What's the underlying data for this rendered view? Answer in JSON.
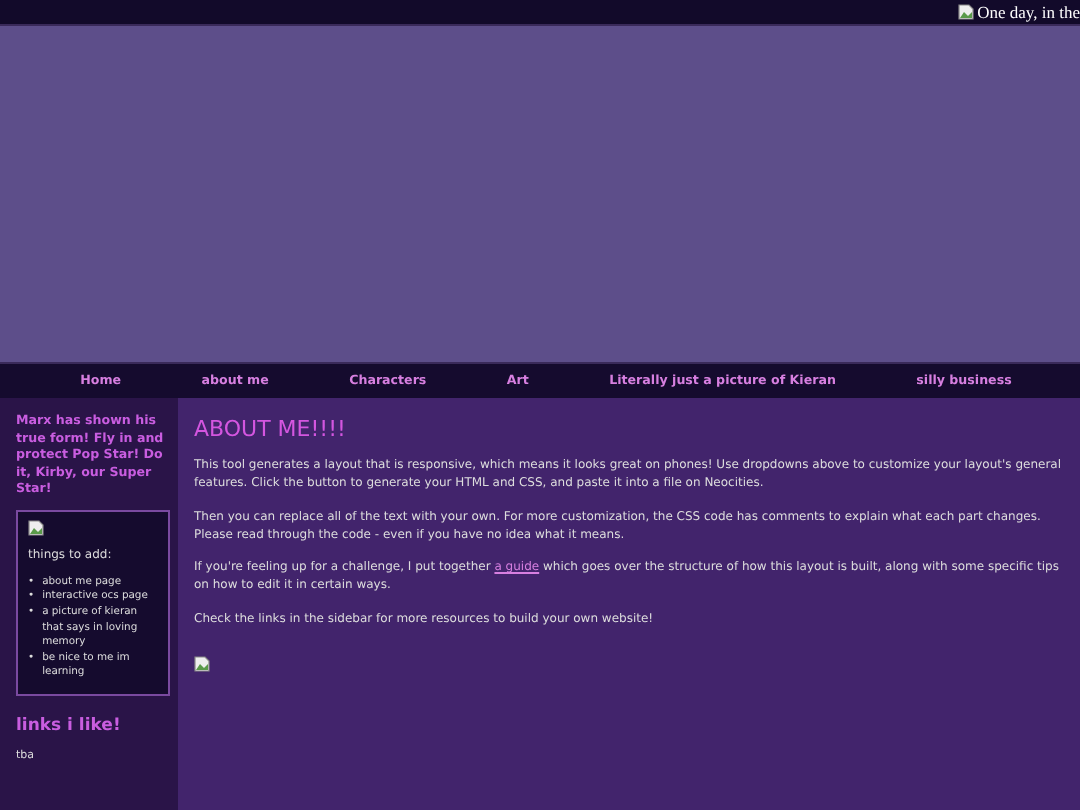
{
  "top_bar": {
    "marquee": "One day, in the"
  },
  "nav": [
    {
      "label": "Home"
    },
    {
      "label": "about me"
    },
    {
      "label": "Characters"
    },
    {
      "label": "Art"
    },
    {
      "label": "Literally just a picture of Kieran"
    },
    {
      "label": "silly business"
    }
  ],
  "sidebar": {
    "intro": "Marx has shown his true form! Fly in and protect Pop Star! Do it, Kirby, our Super Star!",
    "box": {
      "title": "things to add:",
      "items": [
        {
          "bullet": "•",
          "text": "about me page"
        },
        {
          "bullet": "•",
          "text": "interactive ocs page"
        },
        {
          "bullet": "•",
          "text": "a picture of kieran that says in loving memory"
        },
        {
          "bullet": "•",
          "text": "be nice to me im learning"
        }
      ]
    },
    "links_heading": "links i like!",
    "links_text": "tba"
  },
  "main": {
    "heading": "ABOUT ME!!!!",
    "paragraphs": [
      "This tool generates a layout that is responsive, which means it looks great on phones! Use dropdowns above to customize your layout's general features. Click the button to generate your HTML and CSS, and paste it into a file on Neocities.",
      "Then you can replace all of the text with your own. For more customization, the CSS code has comments to explain what each part changes. Please read through the code - even if you have no idea what it means.",
      {
        "before": "If you're feeling up for a challenge, I put together",
        "link": "a guide",
        "after": "which goes over the structure of how this layout is built, along with some specific tips on how to edit it in certain ways."
      },
      "Check the links in the sidebar for more resources to build your own website!"
    ]
  }
}
